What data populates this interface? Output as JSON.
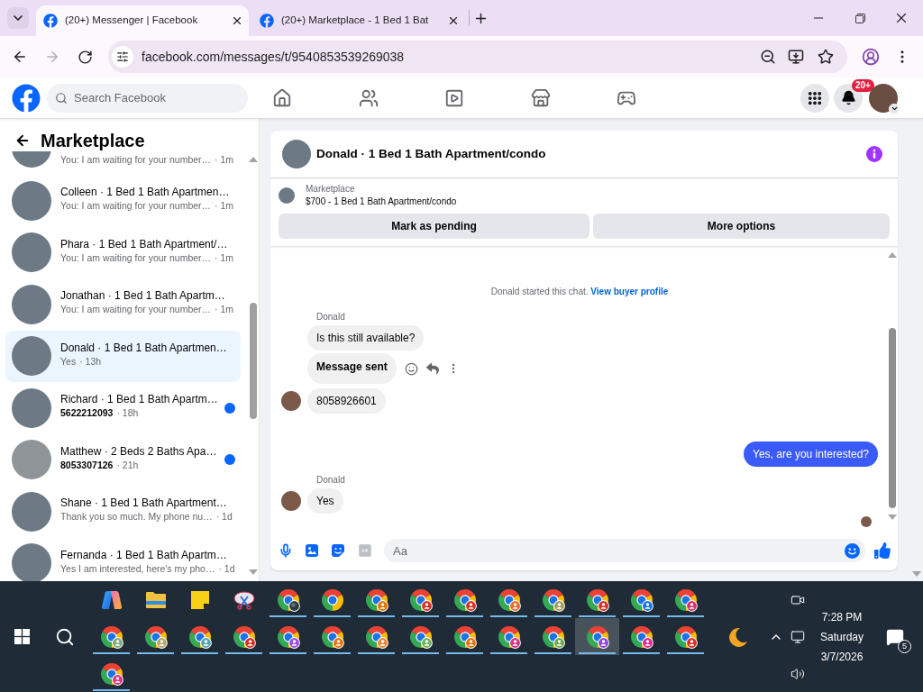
{
  "browser": {
    "tabs": [
      {
        "title": "(20+) Messenger | Facebook",
        "selected": true
      },
      {
        "title": "(20+) Marketplace - 1 Bed 1 Bat",
        "selected": false
      }
    ],
    "forward": {
      "disabled": true
    },
    "url": "facebook.com/messages/t/9540853539269038"
  },
  "header": {
    "search": {
      "placeholder": "Search Facebook"
    },
    "nav": [
      {
        "kind": "home"
      },
      {
        "kind": "friends"
      },
      {
        "kind": "video"
      },
      {
        "kind": "marketplace"
      },
      {
        "kind": "gaming"
      }
    ],
    "notification_badge": "20+"
  },
  "sidebar": {
    "title": "Marketplace",
    "conversations": [
      {
        "preview": "You: I am waiting for your number…",
        "time": "· 1m",
        "selected": false,
        "unread": false
      },
      {
        "title": "Colleen · 1 Bed 1 Bath Apartmen…",
        "preview": "You: I am waiting for your number…",
        "time": "· 1m",
        "selected": false,
        "unread": false
      },
      {
        "title": "Phara · 1 Bed 1 Bath Apartment/…",
        "preview": "You: I am waiting for your number…",
        "time": "· 1m",
        "selected": false,
        "unread": false
      },
      {
        "title": "Jonathan · 1 Bed 1 Bath Apartm…",
        "preview": "You: I am waiting for your number…",
        "time": "· 1m",
        "selected": false,
        "unread": false
      },
      {
        "title": "Donald · 1 Bed 1 Bath Apartmen…",
        "preview": "Yes",
        "time": "· 13h",
        "selected": true,
        "unread": false
      },
      {
        "title": "Richard · 1 Bed 1 Bath Apartm…",
        "preview": "5622212093",
        "time": "· 18h",
        "selected": false,
        "unread": true
      },
      {
        "title": "Matthew · 2 Beds 2 Baths Apa…",
        "preview": "8053307126",
        "time": "· 21h",
        "selected": false,
        "unread": true
      },
      {
        "title": "Shane · 1 Bed 1 Bath Apartment…",
        "preview": "Thank you so much. My phone nu…",
        "time": "· 1d",
        "selected": false,
        "unread": false
      },
      {
        "title": "Fernanda · 1 Bed 1 Bath Apartm…",
        "preview": "Yes I am interested, here's my pho…",
        "time": "· 1d",
        "selected": false,
        "unread": false
      }
    ]
  },
  "chat": {
    "title": "Donald · 1 Bed 1 Bath Apartment/condo",
    "listing": {
      "source": "Marketplace",
      "title": "$700 - 1 Bed 1 Bath Apartment/condo"
    },
    "actions": [
      "Mark as pending",
      "More options"
    ],
    "intro": {
      "text": "Donald started this chat.",
      "link": "View buyer profile"
    },
    "messages": [
      {
        "kind": "sender",
        "text": "Donald"
      },
      {
        "kind": "incoming",
        "text": "Is this still available?",
        "avatar": false,
        "bold": false,
        "actions": false
      },
      {
        "kind": "incoming",
        "text": "Message sent",
        "avatar": false,
        "bold": true,
        "actions": true
      },
      {
        "kind": "incoming",
        "text": "8058926601",
        "avatar": true,
        "bold": false,
        "actions": false
      },
      {
        "kind": "outgoing",
        "text": "Yes, are you interested?"
      },
      {
        "kind": "sender",
        "text": "Donald"
      },
      {
        "kind": "incoming",
        "text": "Yes",
        "avatar": true,
        "bold": false,
        "actions": false
      }
    ],
    "seen": true,
    "composer": {
      "placeholder": "Aa"
    }
  },
  "taskbar": {
    "apps": [
      {
        "kind": "copilot",
        "running": false,
        "selected": false
      },
      {
        "kind": "file-explorer",
        "running": false,
        "selected": false
      },
      {
        "kind": "sticky-notes",
        "running": false,
        "selected": false
      },
      {
        "kind": "snipping-tool",
        "running": false,
        "selected": false
      },
      {
        "kind": "chrome-photo",
        "running": true,
        "selected": false
      },
      {
        "kind": "chrome",
        "running": true,
        "selected": false
      },
      {
        "kind": "chrome-profile",
        "color": "#e37400",
        "running": true,
        "selected": false
      },
      {
        "kind": "chrome-profile",
        "color": "#d93025",
        "running": true,
        "selected": false
      },
      {
        "kind": "chrome-profile",
        "color": "#d93025",
        "running": true,
        "selected": false
      },
      {
        "kind": "chrome-profile",
        "color": "#ea6a2d",
        "running": true,
        "selected": false
      },
      {
        "kind": "chrome-profile",
        "color": "#a39e63",
        "running": true,
        "selected": false
      },
      {
        "kind": "chrome-profile",
        "color": "#d93025",
        "running": true,
        "selected": false
      },
      {
        "kind": "chrome-profile",
        "color": "#1a73e8",
        "running": true,
        "selected": false
      },
      {
        "kind": "chrome-profile",
        "color": "#d93068",
        "running": true,
        "selected": false
      },
      {
        "kind": "chrome-profile",
        "color": "#7cab7a",
        "running": true,
        "selected": false
      },
      {
        "kind": "chrome-profile",
        "color": "#b5a86a",
        "running": true,
        "selected": false
      },
      {
        "kind": "chrome-profile",
        "color": "#5aa3b0",
        "running": true,
        "selected": false
      },
      {
        "kind": "chrome-profile",
        "color": "#d93025",
        "running": true,
        "selected": false
      },
      {
        "kind": "chrome-profile",
        "color": "#9c4fe0",
        "running": true,
        "selected": false
      },
      {
        "kind": "chrome-profile",
        "color": "#e8710a",
        "running": true,
        "selected": false
      },
      {
        "kind": "chrome-profile",
        "color": "#e8893a",
        "running": true,
        "selected": false
      },
      {
        "kind": "chrome-profile",
        "color": "#78b160",
        "running": true,
        "selected": false
      },
      {
        "kind": "chrome-profile",
        "color": "#e8710a",
        "running": true,
        "selected": false
      },
      {
        "kind": "chrome-profile",
        "color": "#d63384",
        "running": true,
        "selected": false
      },
      {
        "kind": "chrome-profile",
        "color": "#6aa84f",
        "running": true,
        "selected": false
      },
      {
        "kind": "chrome-profile",
        "color": "#8e44d8",
        "running": true,
        "selected": true
      },
      {
        "kind": "chrome-profile",
        "color": "#e52592",
        "running": true,
        "selected": false
      },
      {
        "kind": "chrome-profile",
        "color": "#d93025",
        "running": true,
        "selected": false
      },
      {
        "kind": "chrome-profile",
        "color": "#d63384",
        "running": true,
        "selected": false
      }
    ],
    "clock": {
      "time": "7:28 PM",
      "day": "Saturday",
      "date": "3/7/2026"
    },
    "notification_count": "5"
  }
}
